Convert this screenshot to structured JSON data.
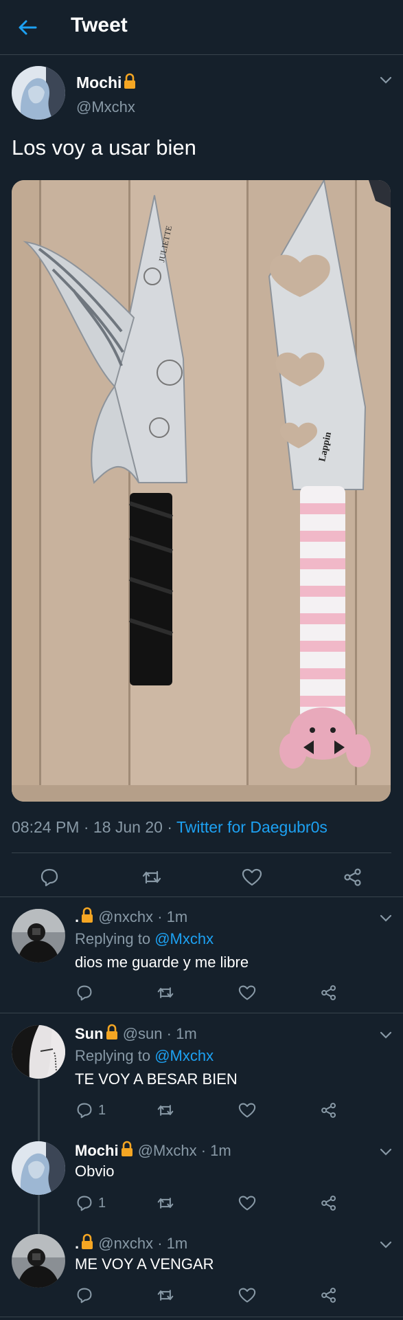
{
  "header": {
    "title": "Tweet",
    "back_icon": "arrow-left-icon"
  },
  "colors": {
    "background": "#15202b",
    "accent": "#1da1f2",
    "muted": "#8899a6",
    "divider": "#38444d",
    "lock": "#f5a623"
  },
  "tweet": {
    "display_name": "Mochi",
    "handle": "@Mxchx",
    "text": "Los voy a usar bien",
    "time": "08:24 PM",
    "date": "18 Jun 20",
    "separator": "·",
    "source": "Twitter for Daegubr0s",
    "image_caption_left_blade": "JULIETTE",
    "image_caption_right_blade": "Lappin"
  },
  "replies": [
    {
      "display_name": ".",
      "handle": "@nxchx",
      "age": "1m",
      "replying_label": "Replying to",
      "replying_to": "@Mxchx",
      "text": "dios me guarde y me libre",
      "reply_count": ""
    },
    {
      "display_name": "Sun",
      "handle": "@sun",
      "age": "1m",
      "replying_label": "Replying to",
      "replying_to": "@Mxchx",
      "text": "TE VOY A BESAR BIEN",
      "reply_count": "1"
    },
    {
      "display_name": "Mochi",
      "handle": "@Mxchx",
      "age": "1m",
      "text": "Obvio",
      "reply_count": "1"
    },
    {
      "display_name": ".",
      "handle": "@nxchx",
      "age": "1m",
      "text": "ME VOY A VENGAR",
      "reply_count": ""
    }
  ]
}
